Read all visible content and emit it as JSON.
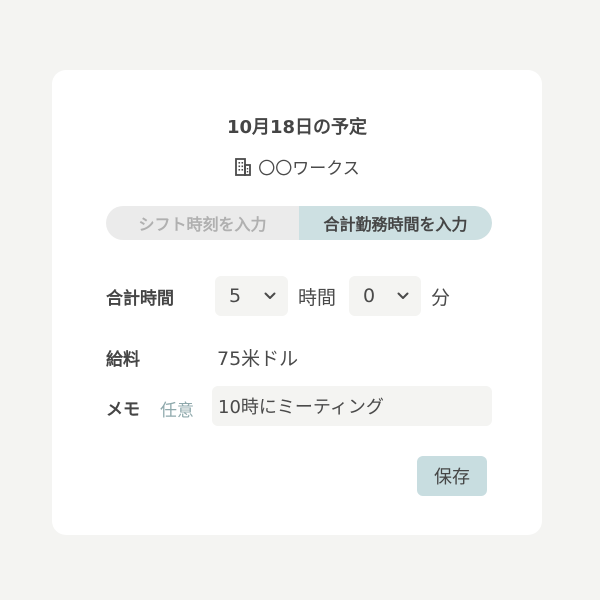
{
  "header": {
    "title": "10月18日の予定",
    "workplace": "〇〇ワークス",
    "workplace_icon": "building-icon"
  },
  "mode_toggle": {
    "options": [
      {
        "label": "シフト時刻を入力",
        "selected": false
      },
      {
        "label": "合計勤務時間を入力",
        "selected": true
      }
    ]
  },
  "total_time": {
    "label": "合計時間",
    "hours_value": "5",
    "hours_unit": "時間",
    "minutes_value": "0",
    "minutes_unit": "分"
  },
  "salary": {
    "label": "給料",
    "value": "75米ドル"
  },
  "memo": {
    "label": "メモ",
    "optional_label": "任意",
    "value": "10時にミーティング"
  },
  "actions": {
    "save_label": "保存"
  },
  "colors": {
    "background": "#f4f4f2",
    "card": "#ffffff",
    "accent": "#cde0e2",
    "optional_text": "#8fa9ac"
  }
}
